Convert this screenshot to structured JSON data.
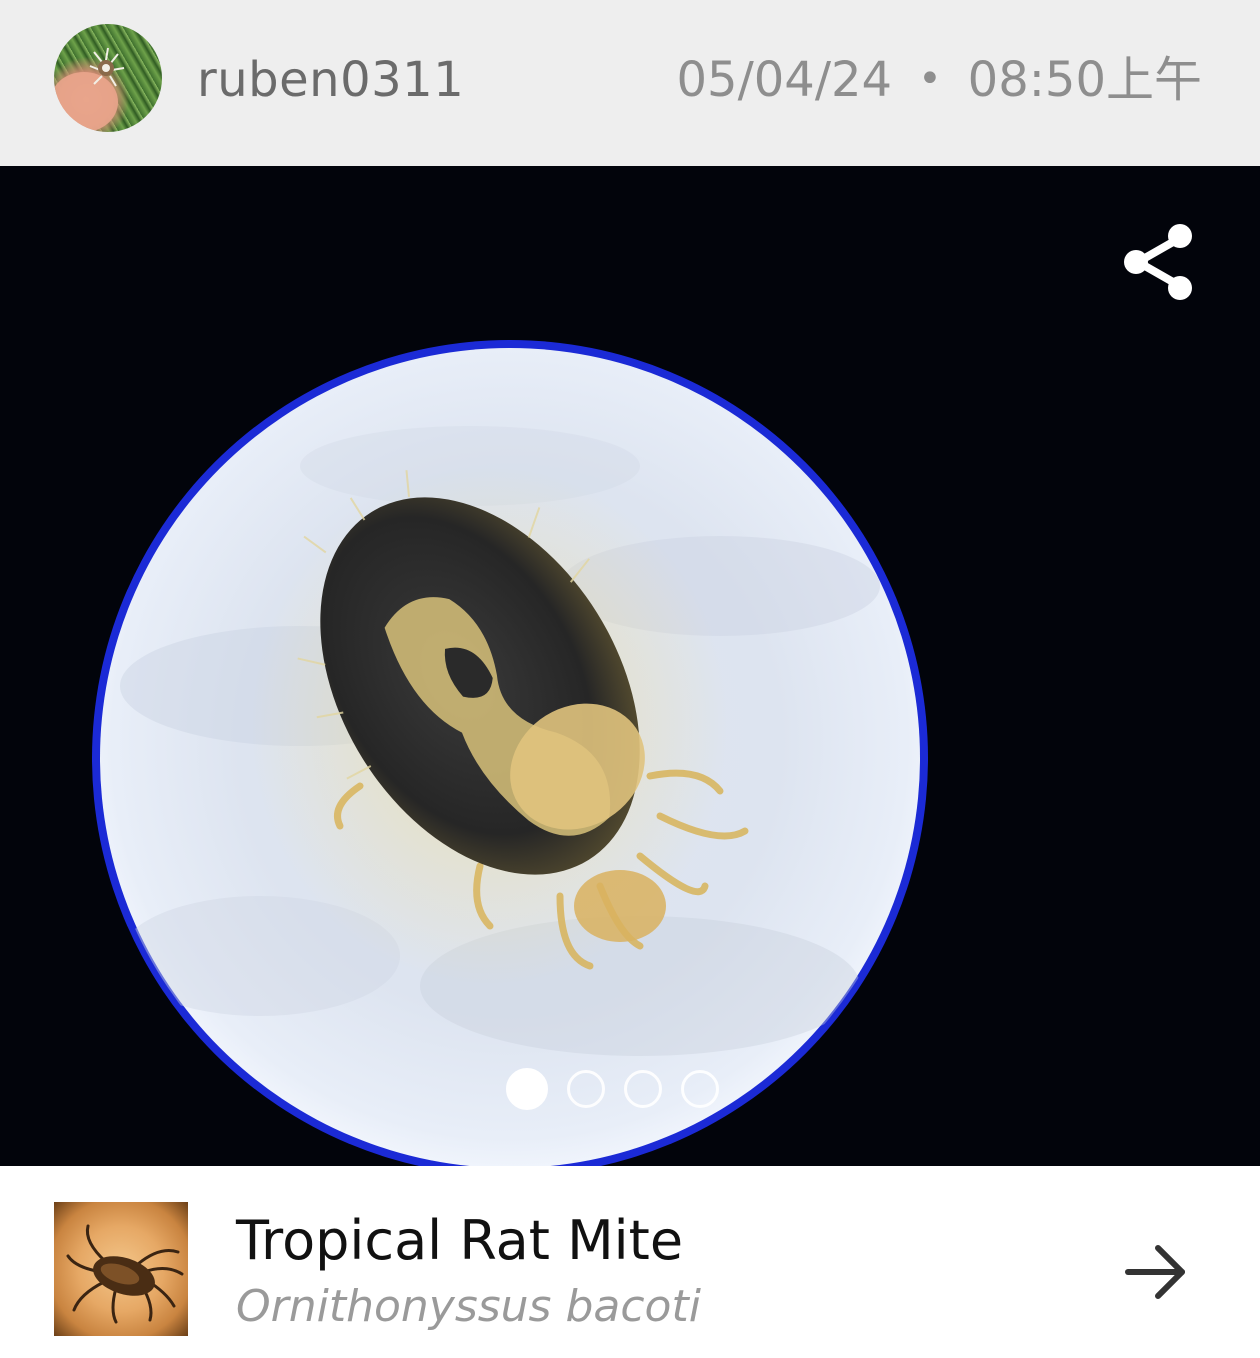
{
  "header": {
    "username": "ruben0311",
    "date": "05/04/24",
    "separator": "•",
    "time": "08:50上午"
  },
  "photo": {
    "alt": "",
    "page_indicator": {
      "total": 4,
      "active": 1
    }
  },
  "icons": {
    "share": "share-icon",
    "arrow": "arrow-right-icon"
  },
  "species": {
    "common_name": "Tropical Rat Mite",
    "scientific_name": "Ornithonyssus bacoti"
  },
  "colors": {
    "header_bg": "#eeeeee",
    "photo_bg": "#02040b",
    "ring": "#1a2bd8"
  }
}
